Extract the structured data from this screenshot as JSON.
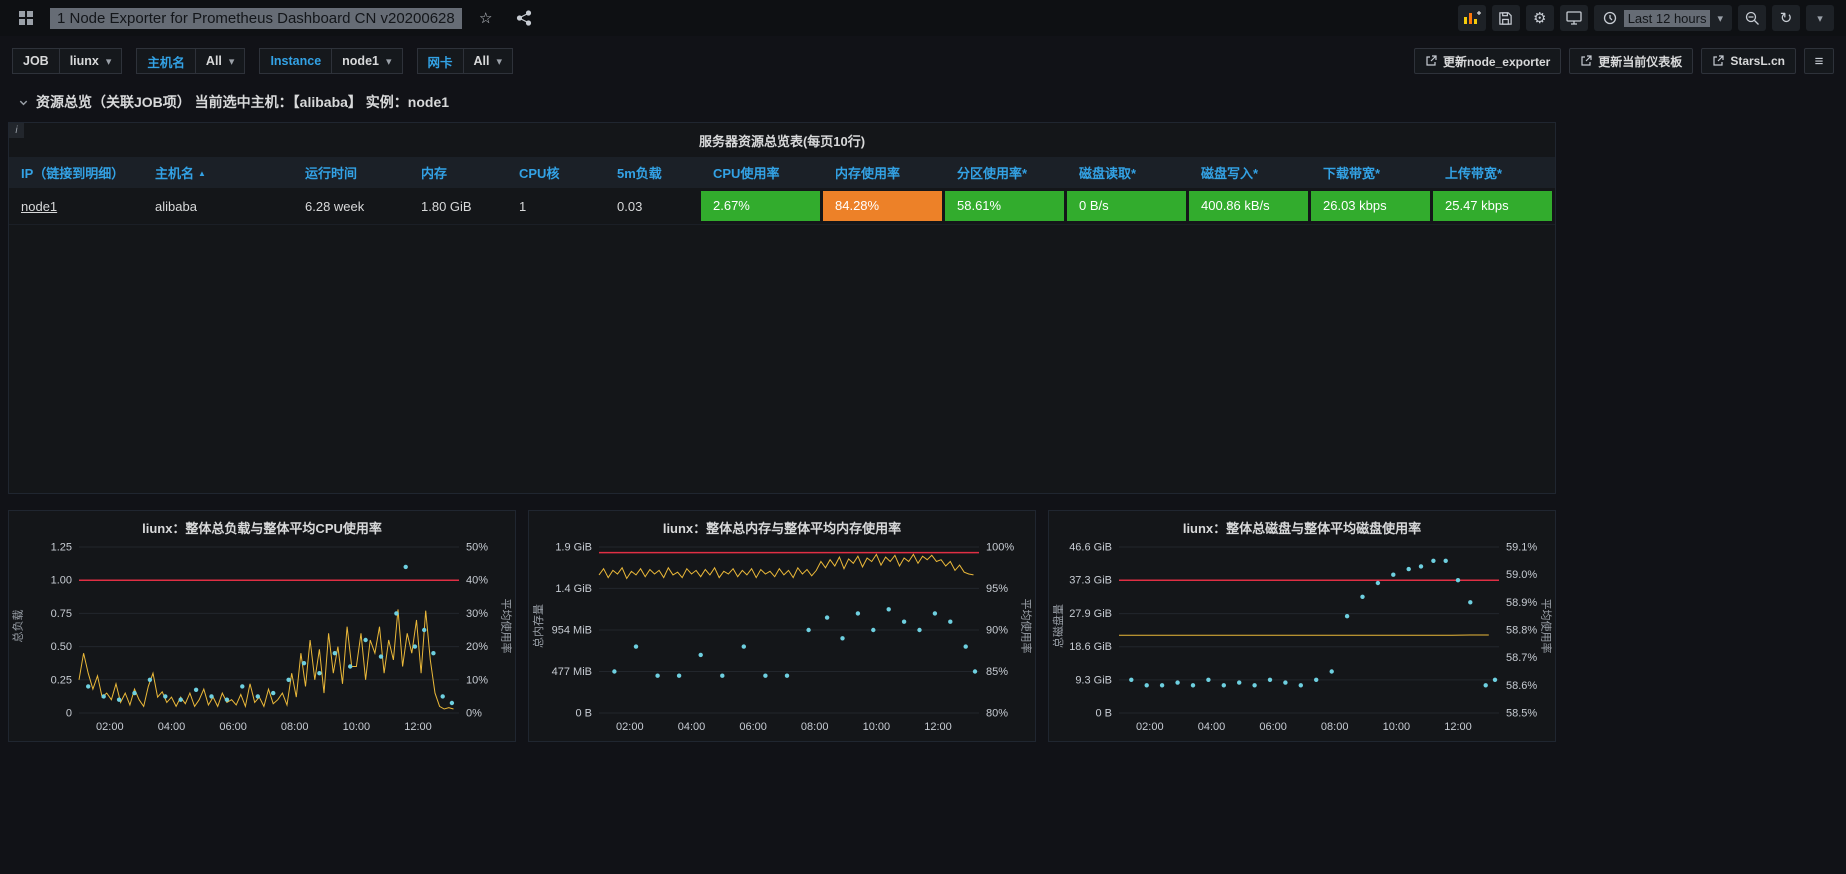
{
  "colors": {
    "green": "#32ac2d",
    "orange": "#ed8128",
    "blue": "#33a2e5",
    "yellow": "#eab839",
    "red": "#e02f44",
    "cyan": "#6ed0e0"
  },
  "icons": {
    "star": "☆",
    "gear": "⚙",
    "refresh": "↻",
    "caret_down": "▾",
    "menu": "≡",
    "info": "i",
    "sort_asc": "▲"
  },
  "navbar": {
    "title": "1 Node Exporter for Prometheus Dashboard CN v20200628",
    "time_range": "Last 12 hours"
  },
  "submenu": {
    "variables": [
      {
        "label": "JOB",
        "value": "liunx"
      },
      {
        "label": "主机名",
        "value": "All"
      },
      {
        "label": "Instance",
        "value": "node1"
      },
      {
        "label": "网卡",
        "value": "All"
      }
    ],
    "buttons": [
      {
        "label": "更新node_exporter"
      },
      {
        "label": "更新当前仪表板"
      },
      {
        "label": "StarsL.cn"
      }
    ]
  },
  "row_header": {
    "title": "资源总览（关联JOB项） 当前选中主机：【alibaba】 实例：node1"
  },
  "table_panel": {
    "title": "服务器资源总览表(每页10行)",
    "columns": [
      "IP（链接到明细）",
      "主机名",
      "运行时间",
      "内存",
      "CPU核",
      "5m负载",
      "CPU使用率",
      "内存使用率",
      "分区使用率*",
      "磁盘读取*",
      "磁盘写入*",
      "下载带宽*",
      "上传带宽*"
    ],
    "rows": [
      {
        "ip": "node1",
        "hostname": "alibaba",
        "uptime": "6.28 week",
        "memory": "1.80 GiB",
        "cpu_cores": "1",
        "load_5m": "0.03",
        "stats": [
          {
            "value": "2.67%",
            "color": "green"
          },
          {
            "value": "84.28%",
            "color": "orange"
          },
          {
            "value": "58.61%",
            "color": "green"
          },
          {
            "value": "0 B/s",
            "color": "green"
          },
          {
            "value": "400.86 kB/s",
            "color": "green"
          },
          {
            "value": "26.03 kbps",
            "color": "green"
          },
          {
            "value": "25.47 kbps",
            "color": "green"
          }
        ]
      }
    ]
  },
  "chart_data": [
    {
      "type": "line+scatter",
      "title": "liunx：整体总负载与整体平均CPU使用率",
      "x_min": 1,
      "x_max": 13.33,
      "x_ticks": [
        {
          "v": 2,
          "label": "02:00"
        },
        {
          "v": 4,
          "label": "04:00"
        },
        {
          "v": 6,
          "label": "06:00"
        },
        {
          "v": 8,
          "label": "08:00"
        },
        {
          "v": 10,
          "label": "10:00"
        },
        {
          "v": 12,
          "label": "12:00"
        }
      ],
      "left_axis": {
        "label": "总负载",
        "min": 0,
        "max": 1.25,
        "ticks": [
          {
            "v": 0,
            "label": "0"
          },
          {
            "v": 0.25,
            "label": "0.25"
          },
          {
            "v": 0.5,
            "label": "0.50"
          },
          {
            "v": 0.75,
            "label": "0.75"
          },
          {
            "v": 1,
            "label": "1.00"
          },
          {
            "v": 1.25,
            "label": "1.25"
          }
        ]
      },
      "right_axis": {
        "label": "平均使用率",
        "min": 0,
        "max": 50,
        "ticks": [
          {
            "v": 0,
            "label": "0%"
          },
          {
            "v": 10,
            "label": "10%"
          },
          {
            "v": 20,
            "label": "20%"
          },
          {
            "v": 30,
            "label": "30%"
          },
          {
            "v": 40,
            "label": "40%"
          },
          {
            "v": 50,
            "label": "50%"
          }
        ]
      },
      "red_line": 1,
      "line_series": {
        "color": "yellow",
        "x_start": 1,
        "x_step": 0.15,
        "y": [
          0.25,
          0.45,
          0.3,
          0.18,
          0.28,
          0.12,
          0.15,
          0.1,
          0.22,
          0.08,
          0.15,
          0.06,
          0.18,
          0.1,
          0.05,
          0.2,
          0.3,
          0.12,
          0.16,
          0.08,
          0.12,
          0.05,
          0.12,
          0.07,
          0.15,
          0.05,
          0.1,
          0.18,
          0.06,
          0.12,
          0.05,
          0.15,
          0.08,
          0.1,
          0.06,
          0.14,
          0.05,
          0.22,
          0.08,
          0.12,
          0.05,
          0.18,
          0.07,
          0.1,
          0.15,
          0.06,
          0.3,
          0.12,
          0.45,
          0.2,
          0.55,
          0.25,
          0.48,
          0.15,
          0.6,
          0.3,
          0.5,
          0.22,
          0.65,
          0.35,
          0.35,
          0.6,
          0.25,
          0.55,
          0.45,
          0.65,
          0.3,
          0.55,
          0.4,
          0.78,
          0.35,
          0.6,
          0.45,
          0.7,
          0.3,
          0.77,
          0.4,
          0.15,
          0.05,
          0.03,
          0.04,
          0.03
        ]
      },
      "dot_series": {
        "color": "cyan",
        "x": [
          1.3,
          1.8,
          2.3,
          2.8,
          3.3,
          3.8,
          4.3,
          4.8,
          5.3,
          5.8,
          6.3,
          6.8,
          7.3,
          7.8,
          8.3,
          8.8,
          9.3,
          9.8,
          10.3,
          10.8,
          11.3,
          11.6,
          11.9,
          12.2,
          12.5,
          12.8,
          13.1
        ],
        "y": [
          8,
          5,
          4,
          6,
          10,
          5,
          4,
          7,
          5,
          4,
          8,
          5,
          6,
          10,
          15,
          12,
          18,
          14,
          22,
          17,
          30,
          44,
          20,
          25,
          18,
          5,
          3
        ]
      }
    },
    {
      "type": "line+scatter",
      "title": "liunx：整体总内存与整体平均内存使用率",
      "x_min": 1,
      "x_max": 13.33,
      "x_ticks": [
        {
          "v": 2,
          "label": "02:00"
        },
        {
          "v": 4,
          "label": "04:00"
        },
        {
          "v": 6,
          "label": "06:00"
        },
        {
          "v": 8,
          "label": "08:00"
        },
        {
          "v": 10,
          "label": "10:00"
        },
        {
          "v": 12,
          "label": "12:00"
        }
      ],
      "left_axis": {
        "label": "总内存量",
        "min": 0,
        "max": 1.863,
        "ticks": [
          {
            "v": 0,
            "label": "0 B"
          },
          {
            "v": 0.466,
            "label": "477 MiB"
          },
          {
            "v": 0.932,
            "label": "954 MiB"
          },
          {
            "v": 1.398,
            "label": "1.4 GiB"
          },
          {
            "v": 1.863,
            "label": "1.9 GiB"
          }
        ]
      },
      "right_axis": {
        "label": "平均使用率",
        "min": 80,
        "max": 100,
        "ticks": [
          {
            "v": 80,
            "label": "80%"
          },
          {
            "v": 85,
            "label": "85%"
          },
          {
            "v": 90,
            "label": "90%"
          },
          {
            "v": 95,
            "label": "95%"
          },
          {
            "v": 100,
            "label": "100%"
          }
        ]
      },
      "red_line": 1.8,
      "line_series": {
        "color": "yellow",
        "x_start": 1,
        "x_step": 0.15,
        "y": [
          1.55,
          1.62,
          1.52,
          1.6,
          1.56,
          1.63,
          1.51,
          1.59,
          1.55,
          1.62,
          1.53,
          1.61,
          1.56,
          1.6,
          1.52,
          1.63,
          1.55,
          1.58,
          1.52,
          1.62,
          1.56,
          1.6,
          1.53,
          1.61,
          1.55,
          1.63,
          1.52,
          1.59,
          1.56,
          1.62,
          1.53,
          1.6,
          1.55,
          1.62,
          1.52,
          1.61,
          1.56,
          1.59,
          1.53,
          1.62,
          1.55,
          1.6,
          1.52,
          1.63,
          1.56,
          1.61,
          1.54,
          1.6,
          1.7,
          1.63,
          1.72,
          1.65,
          1.75,
          1.62,
          1.73,
          1.68,
          1.76,
          1.64,
          1.74,
          1.7,
          1.78,
          1.66,
          1.75,
          1.7,
          1.77,
          1.65,
          1.74,
          1.7,
          1.78,
          1.68,
          1.76,
          1.72,
          1.77,
          1.7,
          1.72,
          1.65,
          1.7,
          1.6,
          1.66,
          1.58,
          1.56,
          1.55
        ]
      },
      "dot_series": {
        "color": "cyan",
        "x": [
          1.5,
          2.2,
          2.9,
          3.6,
          4.3,
          5.0,
          5.7,
          6.4,
          7.1,
          7.8,
          8.4,
          8.9,
          9.4,
          9.9,
          10.4,
          10.9,
          11.4,
          11.9,
          12.4,
          12.9,
          13.2
        ],
        "y": [
          85,
          88,
          84.5,
          84.5,
          87,
          84.5,
          88,
          84.5,
          84.5,
          90,
          91.5,
          89,
          92,
          90,
          92.5,
          91,
          90,
          92,
          91,
          88,
          85
        ]
      }
    },
    {
      "type": "line+scatter",
      "title": "liunx：整体总磁盘与整体平均磁盘使用率",
      "x_min": 1,
      "x_max": 13.33,
      "x_ticks": [
        {
          "v": 2,
          "label": "02:00"
        },
        {
          "v": 4,
          "label": "04:00"
        },
        {
          "v": 6,
          "label": "06:00"
        },
        {
          "v": 8,
          "label": "08:00"
        },
        {
          "v": 10,
          "label": "10:00"
        },
        {
          "v": 12,
          "label": "12:00"
        }
      ],
      "left_axis": {
        "label": "总磁盘量",
        "min": 0,
        "max": 46.6,
        "ticks": [
          {
            "v": 0,
            "label": "0 B"
          },
          {
            "v": 9.3,
            "label": "9.3 GiB"
          },
          {
            "v": 18.6,
            "label": "18.6 GiB"
          },
          {
            "v": 27.9,
            "label": "27.9 GiB"
          },
          {
            "v": 37.3,
            "label": "37.3 GiB"
          },
          {
            "v": 46.6,
            "label": "46.6 GiB"
          }
        ]
      },
      "right_axis": {
        "label": "平均使用率",
        "min": 58.5,
        "max": 59.1,
        "ticks": [
          {
            "v": 58.5,
            "label": "58.5%"
          },
          {
            "v": 58.6,
            "label": "58.6%"
          },
          {
            "v": 58.7,
            "label": "58.7%"
          },
          {
            "v": 58.8,
            "label": "58.8%"
          },
          {
            "v": 58.9,
            "label": "58.9%"
          },
          {
            "v": 59.0,
            "label": "59.0%"
          },
          {
            "v": 59.1,
            "label": "59.1%"
          }
        ]
      },
      "red_line": 37.25,
      "line_series": {
        "color": "yellow",
        "x_start": 1,
        "x_step": 0.6,
        "y": [
          21.8,
          21.8,
          21.8,
          21.8,
          21.8,
          21.8,
          21.8,
          21.8,
          21.8,
          21.8,
          21.8,
          21.8,
          21.8,
          21.8,
          21.8,
          21.8,
          21.8,
          21.8,
          21.8,
          21.9,
          21.9
        ]
      },
      "dot_series": {
        "color": "cyan",
        "x": [
          1.4,
          1.9,
          2.4,
          2.9,
          3.4,
          3.9,
          4.4,
          4.9,
          5.4,
          5.9,
          6.4,
          6.9,
          7.4,
          7.9,
          8.4,
          8.9,
          9.4,
          9.9,
          10.4,
          10.8,
          11.2,
          11.6,
          12.0,
          12.4,
          12.9,
          13.2
        ],
        "y": [
          58.62,
          58.6,
          58.6,
          58.61,
          58.6,
          58.62,
          58.6,
          58.61,
          58.6,
          58.62,
          58.61,
          58.6,
          58.62,
          58.65,
          58.85,
          58.92,
          58.97,
          59.0,
          59.02,
          59.03,
          59.05,
          59.05,
          58.98,
          58.9,
          58.6,
          58.62
        ]
      }
    }
  ]
}
